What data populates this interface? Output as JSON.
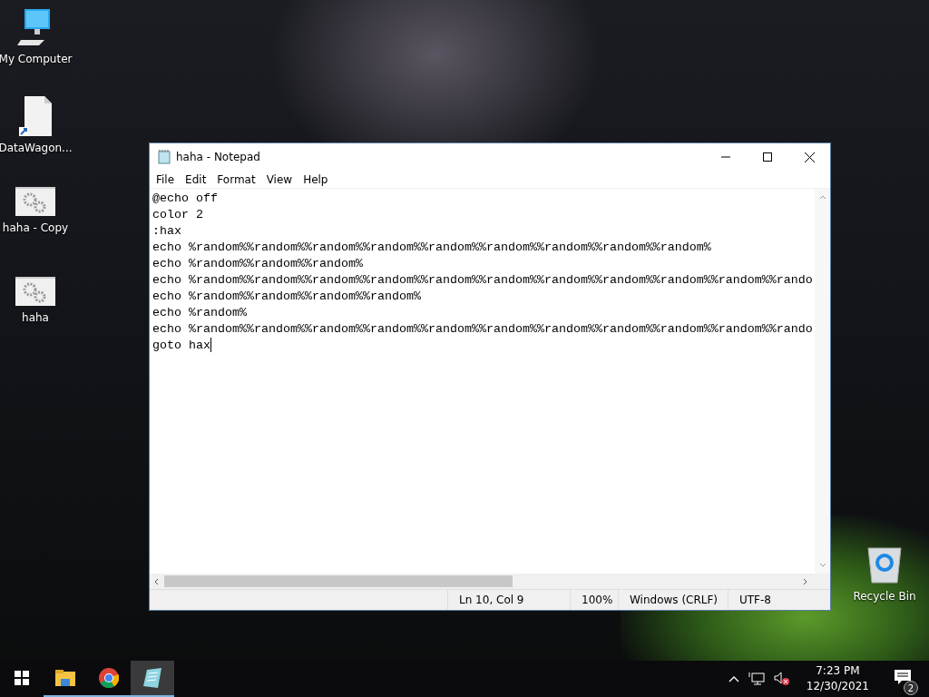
{
  "desktop_icons": [
    {
      "kind": "computer",
      "label": "My Computer"
    },
    {
      "kind": "document",
      "label": "DataWagon..."
    },
    {
      "kind": "program",
      "label": "haha - Copy"
    },
    {
      "kind": "program",
      "label": "haha"
    },
    {
      "kind": "recycle",
      "label": "Recycle Bin"
    }
  ],
  "window": {
    "title": "haha - Notepad",
    "menu": [
      "File",
      "Edit",
      "Format",
      "View",
      "Help"
    ],
    "lines": [
      "@echo off",
      "color 2",
      ":hax",
      "echo %random%%random%%random%%random%%random%%random%%random%%random%%random%",
      "echo %random%%random%%random%",
      "echo %random%%random%%random%%random%%random%%random%%random%%random%%random%%random%%rando",
      "echo %random%%random%%random%%random%",
      "echo %random%",
      "echo %random%%random%%random%%random%%random%%random%%random%%random%%random%%random%%rando",
      "goto hax"
    ],
    "caret_visible": true,
    "status_bar": [
      "Ln 10, Col 9",
      "100%",
      "Windows (CRLF)",
      "UTF-8"
    ]
  },
  "taskbar": {
    "items": [
      {
        "kind": "start",
        "running": false,
        "active": false
      },
      {
        "kind": "folder",
        "running": true,
        "active": false
      },
      {
        "kind": "browser",
        "running": true,
        "active": false
      },
      {
        "kind": "notepad",
        "running": true,
        "active": true
      }
    ],
    "clock": {
      "time": "7:23 PM",
      "date": "12/30/2021"
    },
    "sound_muted": true,
    "notification_count": "2"
  }
}
